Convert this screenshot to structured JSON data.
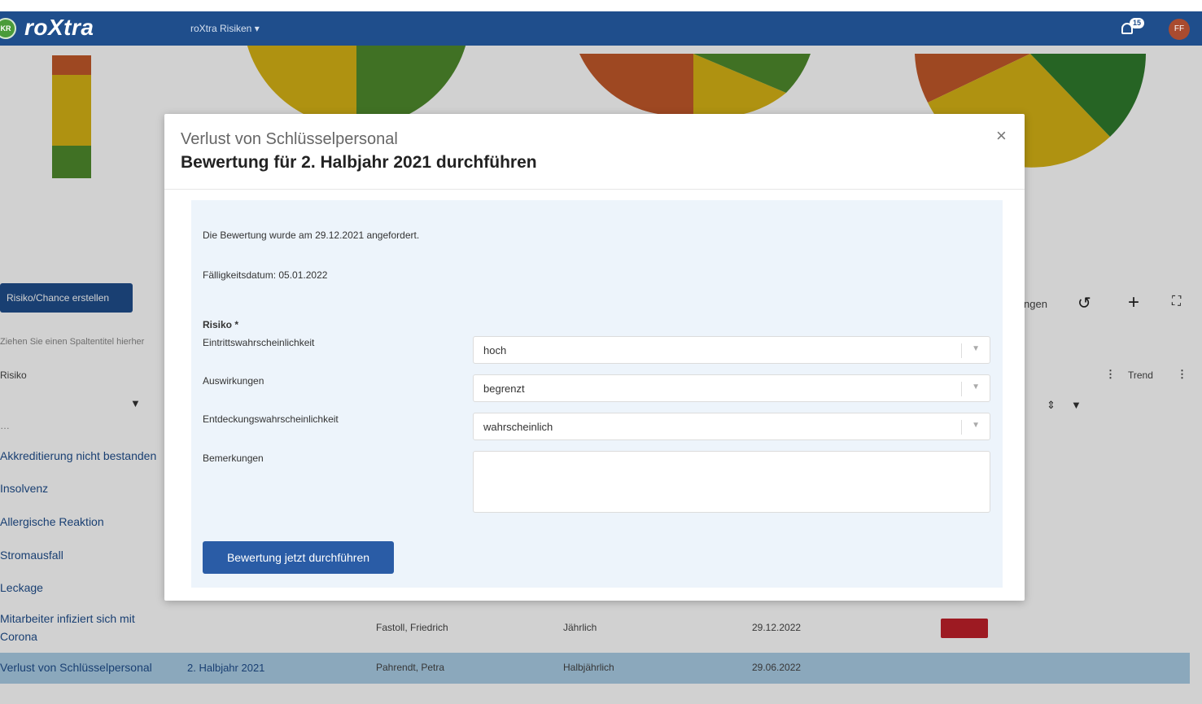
{
  "app": {
    "badge": "KR",
    "name": "roXtra",
    "module_switch": "roXtra Risiken ▾",
    "notification_count": "15",
    "user_initials": "FF"
  },
  "colors": {
    "primary": "#1f4e8c",
    "red": "#c1582a",
    "yellow": "#d6b315",
    "green": "#4f8a2c"
  },
  "toolbar": {
    "create_button": "Risiko/Chance erstellen",
    "group_hint": "Ziehen Sie einen Spaltentitel hierher",
    "partial_label": "ngen",
    "icons": [
      "undo-icon",
      "plus-icon",
      "expand-icon"
    ]
  },
  "table": {
    "col_risk": "Risiko",
    "col_trend": "Trend",
    "partial_row": "…",
    "rows": [
      {
        "risk": "Akkreditierung nicht bestanden"
      },
      {
        "risk": "Insolvenz"
      },
      {
        "risk": "Allergische Reaktion"
      },
      {
        "risk": "Stromausfall"
      },
      {
        "risk": "Leckage"
      },
      {
        "risk": "Mitarbeiter infiziert sich mit",
        "risk2": "Corona",
        "owner": "Fastoll, Friedrich",
        "interval": "Jährlich",
        "date": "29.12.2022"
      },
      {
        "risk": "Verlust von Schlüsselpersonal",
        "period": "2. Halbjahr 2021",
        "owner": "Pahrendt, Petra",
        "interval": "Halbjährlich",
        "date": "29.06.2022"
      }
    ]
  },
  "modal": {
    "subtitle": "Verlust von Schlüsselpersonal",
    "title": "Bewertung für 2. Halbjahr 2021 durchführen",
    "requested": "Die Bewertung wurde am 29.12.2021 angefordert.",
    "due": "Fälligkeitsdatum: 05.01.2022",
    "section": "Risiko *",
    "fields": [
      {
        "label": "Eintrittswahrscheinlichkeit",
        "value": "hoch"
      },
      {
        "label": "Auswirkungen",
        "value": "begrenzt"
      },
      {
        "label": "Entdeckungswahrscheinlichkeit",
        "value": "wahrscheinlich"
      }
    ],
    "remarks_label": "Bemerkungen",
    "submit": "Bewertung jetzt durchführen"
  }
}
